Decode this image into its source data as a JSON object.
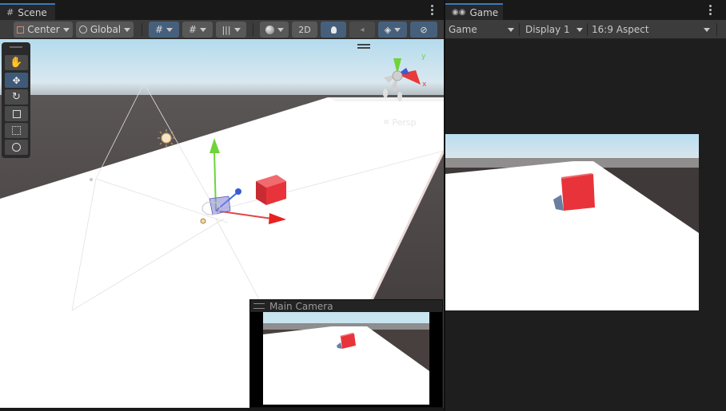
{
  "scene_panel": {
    "tab_label": "Scene",
    "toolbar": {
      "pivot_label": "Center",
      "space_label": "Global",
      "mode_2d_label": "2D"
    },
    "tools": [
      "hand",
      "move",
      "rotate",
      "scale",
      "rect",
      "transform"
    ],
    "gizmo": {
      "persp_label": "Persp",
      "y_label": "y",
      "x_label": "x"
    },
    "camera_preview": {
      "title": "Main Camera"
    }
  },
  "game_panel": {
    "tab_label": "Game",
    "toolbar": {
      "view_label": "Game",
      "display_label": "Display 1",
      "aspect_label": "16:9 Aspect"
    }
  },
  "colors": {
    "accent": "#3a79bb",
    "cube": "#e8333a",
    "plane": "#ffffff",
    "ground": "#3b3534"
  }
}
